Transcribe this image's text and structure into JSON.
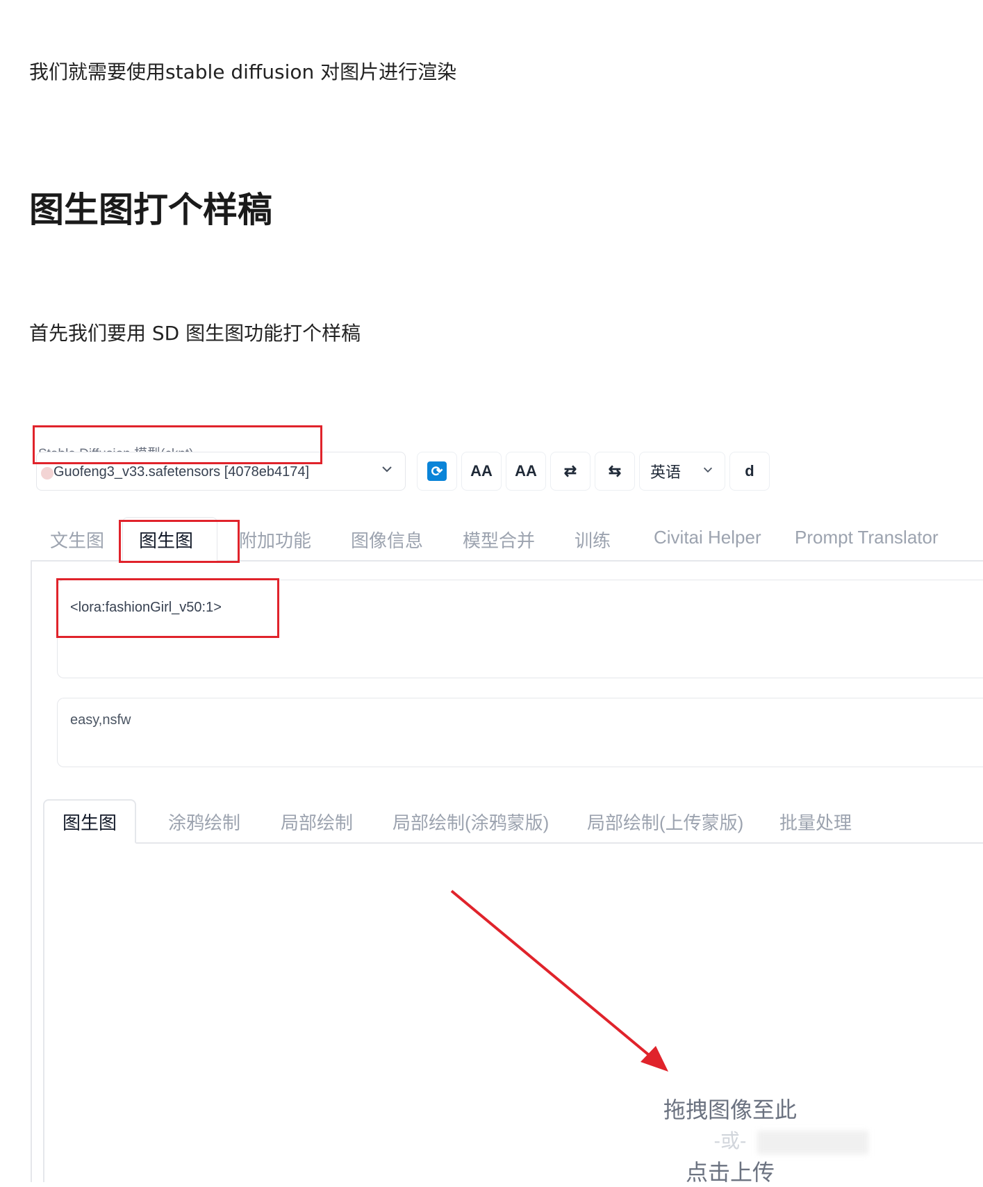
{
  "article": {
    "intro": "我们就需要使用stable diffusion 对图片进行渲染",
    "heading": "图生图打个样稿",
    "sub": "首先我们要用 SD 图生图功能打个样稿"
  },
  "webui": {
    "model_label": "Stable Diffusion 模型(ckpt)",
    "model_value": "Guofeng3_v33.safetensors [4078eb4174]",
    "toolbar": {
      "font_a_label": "AA",
      "font_b_label": "AA",
      "swap_label": "⇄",
      "swap2_label": "⇆",
      "lang_label": "英语",
      "d_label": "d"
    },
    "main_tabs": [
      "文生图",
      "图生图",
      "附加功能",
      "图像信息",
      "模型合并",
      "训练",
      "Civitai Helper",
      "Prompt Translator"
    ],
    "active_main_tab": "图生图",
    "positive_prompt": "<lora:fashionGirl_v50:1>",
    "negative_prompt": "easy,nsfw",
    "sub_tabs": [
      "图生图",
      "涂鸦绘制",
      "局部绘制",
      "局部绘制(涂鸦蒙版)",
      "局部绘制(上传蒙版)",
      "批量处理"
    ],
    "active_sub_tab": "图生图",
    "upload": {
      "drop": "拖拽图像至此",
      "or": "-或-",
      "click": "点击上传"
    }
  },
  "colors": {
    "annotation_red": "#e0232b",
    "refresh_blue": "#0a84d8"
  },
  "icons": [
    "refresh-icon",
    "chevron-down-icon",
    "swap-icon"
  ]
}
